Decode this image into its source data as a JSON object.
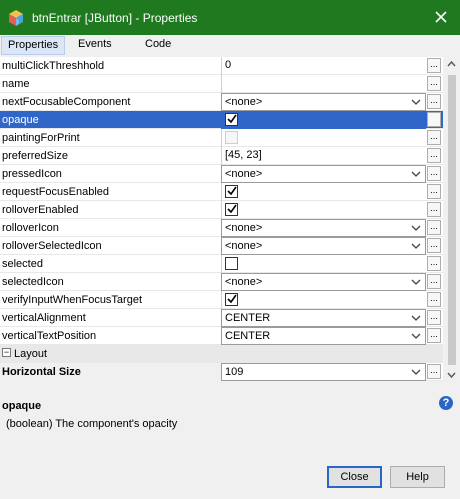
{
  "window": {
    "title": "btnEntrar [JButton] - Properties"
  },
  "tabs": [
    {
      "label": "Properties",
      "active": true
    },
    {
      "label": "Events",
      "active": false
    },
    {
      "label": "Code",
      "active": false
    }
  ],
  "rows": [
    {
      "name": "multiClickThreshhold",
      "value": "0",
      "type": "text"
    },
    {
      "name": "name",
      "value": "",
      "type": "text"
    },
    {
      "name": "nextFocusableComponent",
      "value": "<none>",
      "type": "dropdown"
    },
    {
      "name": "opaque",
      "value": true,
      "type": "checkbox",
      "selected": true
    },
    {
      "name": "paintingForPrint",
      "value": false,
      "type": "checkbox-disabled"
    },
    {
      "name": "preferredSize",
      "value": "[45, 23]",
      "type": "text"
    },
    {
      "name": "pressedIcon",
      "value": "<none>",
      "type": "dropdown"
    },
    {
      "name": "requestFocusEnabled",
      "value": true,
      "type": "checkbox"
    },
    {
      "name": "rolloverEnabled",
      "value": true,
      "type": "checkbox"
    },
    {
      "name": "rolloverIcon",
      "value": "<none>",
      "type": "dropdown"
    },
    {
      "name": "rolloverSelectedIcon",
      "value": "<none>",
      "type": "dropdown"
    },
    {
      "name": "selected",
      "value": false,
      "type": "checkbox"
    },
    {
      "name": "selectedIcon",
      "value": "<none>",
      "type": "dropdown"
    },
    {
      "name": "verifyInputWhenFocusTarget",
      "value": true,
      "type": "checkbox"
    },
    {
      "name": "verticalAlignment",
      "value": "CENTER",
      "type": "dropdown"
    },
    {
      "name": "verticalTextPosition",
      "value": "CENTER",
      "type": "dropdown"
    }
  ],
  "section": {
    "label": "Layout",
    "toggle": "−"
  },
  "layout_rows": [
    {
      "name": "Horizontal Size",
      "value": "109",
      "type": "dropdown"
    }
  ],
  "description": {
    "title": "opaque",
    "text": "(boolean) The component's opacity"
  },
  "buttons": {
    "close": "Close",
    "help": "Help"
  },
  "colors": {
    "titlebar": "#1f7a1f",
    "selection": "#2f66c7",
    "accent": "#2a66c3"
  },
  "icons": {
    "app": "netbeans-cube-icon",
    "close": "close-icon",
    "dropdown": "chevron-down-icon",
    "help": "help-icon",
    "dots": "ellipsis"
  }
}
